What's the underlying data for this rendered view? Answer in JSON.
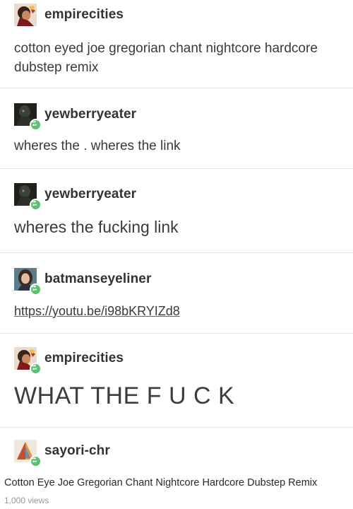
{
  "posts": [
    {
      "username": "empirecities",
      "text": "cotton eyed joe gregorian chant nightcore hardcore dubstep remix",
      "avatar": "empirecities-avatar",
      "reblog": false
    },
    {
      "username": "yewberryeater",
      "text": "wheres the . wheres the link",
      "avatar": "yewberryeater-avatar",
      "reblog": true
    },
    {
      "username": "yewberryeater",
      "text": "wheres the fucking link",
      "avatar": "yewberryeater-avatar",
      "reblog": true
    },
    {
      "username": "batmanseyeliner",
      "text": "https://youtu.be/i98bKRYIZd8",
      "avatar": "batmanseyeliner-avatar",
      "reblog": true
    },
    {
      "username": "empirecities",
      "text": "WHAT THE F U C K",
      "avatar": "empirecities-avatar",
      "reblog": true
    },
    {
      "username": "sayori-chr",
      "avatar": "sayori-chr-avatar",
      "reblog": true
    }
  ],
  "video": {
    "title": "Cotton Eye Joe Gregorian Chant Nightcore Hardcore Dubstep Remix",
    "views": "1,000 views"
  },
  "colors": {
    "reblog_badge": "#5cbf72",
    "divider": "#e6e6e6",
    "text": "#3a3a3a"
  }
}
